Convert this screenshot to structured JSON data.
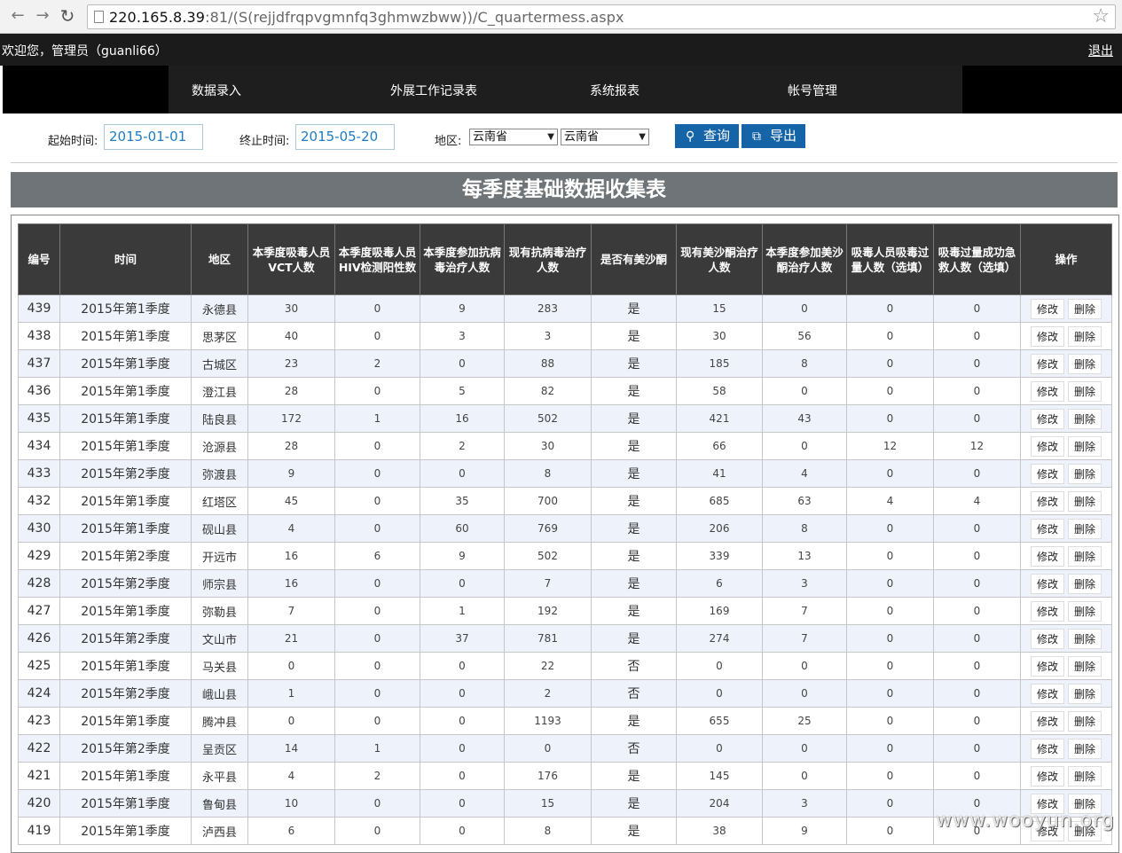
{
  "browser": {
    "url_host": "220.165.8.39",
    "url_rest": ":81/(S(rejjdfrqpvgmnfq3ghmwzbww))/C_quartermess.aspx"
  },
  "header": {
    "welcome": "欢迎您，管理员（guanli66）",
    "logout": "退出"
  },
  "menu": [
    "数据录入",
    "外展工作记录表",
    "系统报表",
    "帐号管理"
  ],
  "filter": {
    "start_label": "起始时间:",
    "start_value": "2015-01-01",
    "end_label": "终止时间:",
    "end_value": "2015-05-20",
    "region_label": "地区:",
    "region1": "云南省",
    "region2": "云南省",
    "query_button": "查询",
    "export_button": "导出"
  },
  "title": "每季度基础数据收集表",
  "table": {
    "headers": [
      "编号",
      "时间",
      "地区",
      "本季度吸毒人员VCT人数",
      "本季度吸毒人员HIV检测阳性数",
      "本季度参加抗病毒治疗人数",
      "现有抗病毒治疗人数",
      "是否有美沙酮",
      "现有美沙酮治疗人数",
      "本季度参加美沙酮治疗人数",
      "吸毒人员吸毒过量人数（选填）",
      "吸毒过量成功急救人数（选填）",
      "操作"
    ],
    "edit_label": "修改",
    "delete_label": "删除",
    "rows": [
      [
        "439",
        "2015年第1季度",
        "永德县",
        "30",
        "0",
        "9",
        "283",
        "是",
        "15",
        "0",
        "0",
        "0"
      ],
      [
        "438",
        "2015年第1季度",
        "思茅区",
        "40",
        "0",
        "3",
        "3",
        "是",
        "30",
        "56",
        "0",
        "0"
      ],
      [
        "437",
        "2015年第1季度",
        "古城区",
        "23",
        "2",
        "0",
        "88",
        "是",
        "185",
        "8",
        "0",
        "0"
      ],
      [
        "436",
        "2015年第1季度",
        "澄江县",
        "28",
        "0",
        "5",
        "82",
        "是",
        "58",
        "0",
        "0",
        "0"
      ],
      [
        "435",
        "2015年第1季度",
        "陆良县",
        "172",
        "1",
        "16",
        "502",
        "是",
        "421",
        "43",
        "0",
        "0"
      ],
      [
        "434",
        "2015年第1季度",
        "沧源县",
        "28",
        "0",
        "2",
        "30",
        "是",
        "66",
        "0",
        "12",
        "12"
      ],
      [
        "433",
        "2015年第2季度",
        "弥渡县",
        "9",
        "0",
        "0",
        "8",
        "是",
        "41",
        "4",
        "0",
        "0"
      ],
      [
        "432",
        "2015年第1季度",
        "红塔区",
        "45",
        "0",
        "35",
        "700",
        "是",
        "685",
        "63",
        "4",
        "4"
      ],
      [
        "430",
        "2015年第1季度",
        "砚山县",
        "4",
        "0",
        "60",
        "769",
        "是",
        "206",
        "8",
        "0",
        "0"
      ],
      [
        "429",
        "2015年第2季度",
        "开远市",
        "16",
        "6",
        "9",
        "502",
        "是",
        "339",
        "13",
        "0",
        "0"
      ],
      [
        "428",
        "2015年第2季度",
        "师宗县",
        "16",
        "0",
        "0",
        "7",
        "是",
        "6",
        "3",
        "0",
        "0"
      ],
      [
        "427",
        "2015年第1季度",
        "弥勒县",
        "7",
        "0",
        "1",
        "192",
        "是",
        "169",
        "7",
        "0",
        "0"
      ],
      [
        "426",
        "2015年第2季度",
        "文山市",
        "21",
        "0",
        "37",
        "781",
        "是",
        "274",
        "7",
        "0",
        "0"
      ],
      [
        "425",
        "2015年第1季度",
        "马关县",
        "0",
        "0",
        "0",
        "22",
        "否",
        "0",
        "0",
        "0",
        "0"
      ],
      [
        "424",
        "2015年第2季度",
        "峨山县",
        "1",
        "0",
        "0",
        "2",
        "否",
        "0",
        "0",
        "0",
        "0"
      ],
      [
        "423",
        "2015年第1季度",
        "腾冲县",
        "0",
        "0",
        "0",
        "1193",
        "是",
        "655",
        "25",
        "0",
        "0"
      ],
      [
        "422",
        "2015年第2季度",
        "呈贡区",
        "14",
        "1",
        "0",
        "0",
        "否",
        "0",
        "0",
        "0",
        "0"
      ],
      [
        "421",
        "2015年第1季度",
        "永平县",
        "4",
        "2",
        "0",
        "176",
        "是",
        "145",
        "0",
        "0",
        "0"
      ],
      [
        "420",
        "2015年第1季度",
        "鲁甸县",
        "10",
        "0",
        "0",
        "15",
        "是",
        "204",
        "3",
        "0",
        "0"
      ],
      [
        "419",
        "2015年第1季度",
        "泸西县",
        "6",
        "0",
        "0",
        "8",
        "是",
        "38",
        "9",
        "0",
        "0"
      ]
    ]
  },
  "watermark": "www.wooyun.org"
}
